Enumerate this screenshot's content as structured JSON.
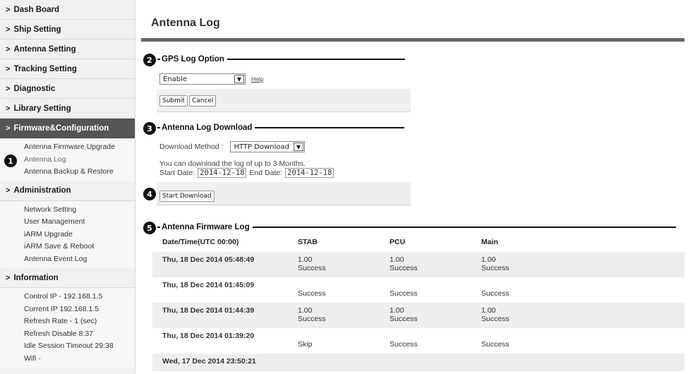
{
  "sidebar": {
    "menus": [
      {
        "label": "Dash Board"
      },
      {
        "label": "Ship Setting"
      },
      {
        "label": "Antenna Setting"
      },
      {
        "label": "Tracking Setting"
      },
      {
        "label": "Diagnostic"
      },
      {
        "label": "Library Setting"
      },
      {
        "label": "Firmware&Configuration"
      },
      {
        "label": "Administration"
      },
      {
        "label": "Information"
      }
    ],
    "firmware_items": [
      "Antenna Firmware Upgrade",
      "Antenna Log",
      "Antenna Backup & Restore"
    ],
    "admin_items": [
      "Network Setting",
      "User Management",
      "iARM Upgrade",
      "iARM Save & Reboot",
      "Antenna Event Log"
    ],
    "info_rows": [
      "Control IP - 192.168.1.5",
      "Current IP  192.168.1.5",
      "Refresh Rate -   1 (sec)",
      "Refresh Disable  8:37",
      "Idle Session Timeout  29:38",
      "Wifi  -"
    ]
  },
  "markers": [
    "1",
    "2",
    "3",
    "4",
    "5"
  ],
  "page_title": "Antenna Log",
  "gps": {
    "title": "GPS Log Option",
    "select_value": "Enable",
    "help": "Help",
    "submit": "Submit",
    "cancel": "Cancel"
  },
  "download": {
    "title": "Antenna Log Download",
    "method_label": "Download Method :",
    "method_value": "HTTP Download",
    "note": "You can download the log of up to 3 Months.",
    "start_label": "Start Date:",
    "start_value": "2014-12-18",
    "end_label": "End Date:",
    "end_value": "2014-12-18",
    "button": "Start Download"
  },
  "firmware_log": {
    "title": "Antenna Firmware Log",
    "columns": [
      "Date/Time(UTC 00:00)",
      "STAB",
      "PCU",
      "Main"
    ],
    "rows": [
      {
        "date": "Thu, 18 Dec 2014 05:48:49",
        "stab": [
          "1.00",
          "Success"
        ],
        "pcu": [
          "1.00",
          "Success"
        ],
        "main": [
          "1.00",
          "Success"
        ]
      },
      {
        "date": "Thu, 18 Dec 2014 01:45:09",
        "stab": [
          "",
          "Success"
        ],
        "pcu": [
          "",
          "Success"
        ],
        "main": [
          "",
          "Success"
        ]
      },
      {
        "date": "Thu, 18 Dec 2014 01:44:39",
        "stab": [
          "1.00",
          "Success"
        ],
        "pcu": [
          "1.00",
          "Success"
        ],
        "main": [
          "1.00",
          "Success"
        ]
      },
      {
        "date": "Thu, 18 Dec 2014 01:39:20",
        "stab": [
          "",
          "Skip"
        ],
        "pcu": [
          "",
          "Success"
        ],
        "main": [
          "",
          "Success"
        ]
      },
      {
        "date": "Wed, 17 Dec 2014 23:50:21",
        "stab": [
          "",
          ""
        ],
        "pcu": [
          "",
          ""
        ],
        "main": [
          "",
          ""
        ]
      }
    ]
  }
}
